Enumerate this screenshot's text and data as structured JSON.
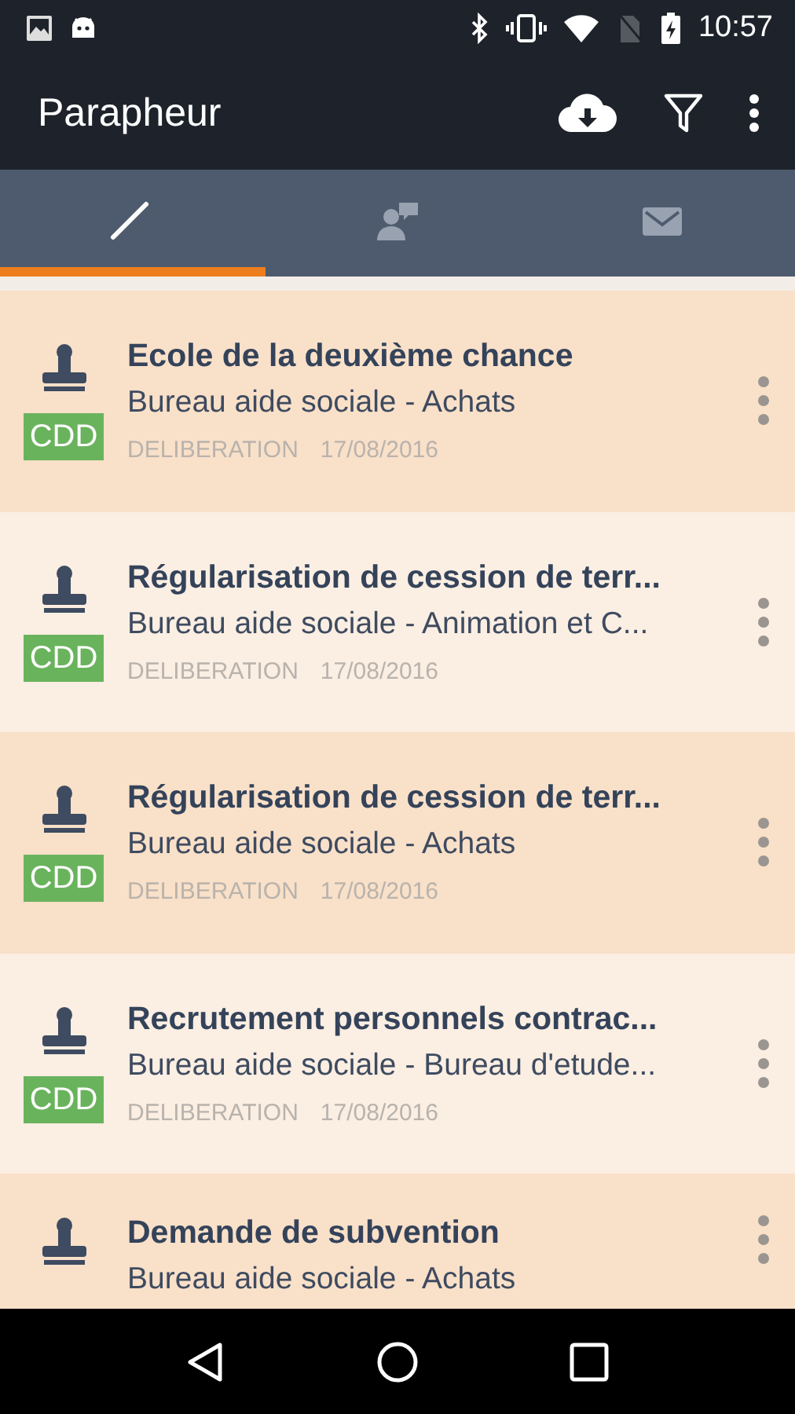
{
  "status_bar": {
    "time": "10:57"
  },
  "app_bar": {
    "title": "Parapheur"
  },
  "tabs": [
    {
      "kind": "pen",
      "selected": true
    },
    {
      "kind": "person",
      "selected": false
    },
    {
      "kind": "mail",
      "selected": false
    }
  ],
  "documents": [
    {
      "title": "Ecole de la deuxième chance",
      "subtitle": "Bureau aide sociale - Achats",
      "badge": "CDD",
      "type": "DELIBERATION",
      "date": "17/08/2016"
    },
    {
      "title": "Régularisation de cession de terr...",
      "subtitle": "Bureau aide sociale - Animation et C...",
      "badge": "CDD",
      "type": "DELIBERATION",
      "date": "17/08/2016"
    },
    {
      "title": "Régularisation de cession de terr...",
      "subtitle": "Bureau aide sociale - Achats",
      "badge": "CDD",
      "type": "DELIBERATION",
      "date": "17/08/2016"
    },
    {
      "title": "Recrutement personnels contrac...",
      "subtitle": "Bureau aide sociale - Bureau d'etude...",
      "badge": "CDD",
      "type": "DELIBERATION",
      "date": "17/08/2016"
    },
    {
      "title": "Demande de subvention",
      "subtitle": "Bureau aide sociale - Achats"
    }
  ]
}
